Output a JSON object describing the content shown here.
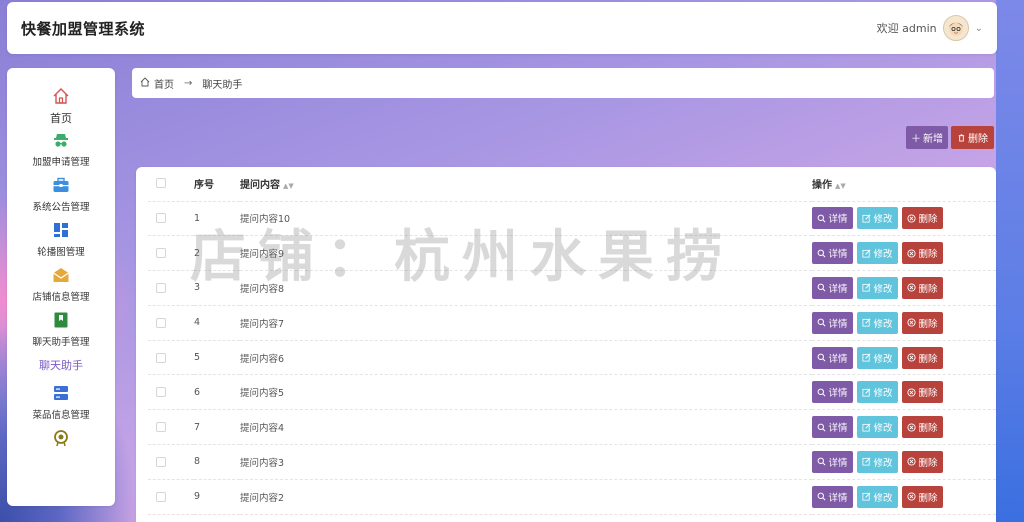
{
  "header": {
    "app_title": "快餐加盟管理系统",
    "welcome": "欢迎 admin"
  },
  "sidebar": {
    "items": [
      {
        "label": "首页",
        "icon": "home-icon"
      },
      {
        "label": "加盟申请管理",
        "icon": "spy-icon"
      },
      {
        "label": "系统公告管理",
        "icon": "briefcase-icon"
      },
      {
        "label": "轮播图管理",
        "icon": "grid-icon"
      },
      {
        "label": "店铺信息管理",
        "icon": "mail-icon"
      },
      {
        "label": "聊天助手管理",
        "icon": "bookmark-icon"
      },
      {
        "label": "菜品信息管理",
        "icon": "server-icon"
      }
    ],
    "active_sub": "聊天助手"
  },
  "breadcrumb": {
    "home": "首页",
    "current": "聊天助手"
  },
  "actions": {
    "add": "新增",
    "delete": "删除"
  },
  "table": {
    "headers": {
      "index": "序号",
      "question": "提问内容",
      "ops": "操作"
    },
    "op_labels": {
      "detail": "详情",
      "edit": "修改",
      "delete": "删除"
    },
    "rows": [
      {
        "index": "1",
        "question": "提问内容10"
      },
      {
        "index": "2",
        "question": "提问内容9"
      },
      {
        "index": "3",
        "question": "提问内容8"
      },
      {
        "index": "4",
        "question": "提问内容7"
      },
      {
        "index": "5",
        "question": "提问内容6"
      },
      {
        "index": "6",
        "question": "提问内容5"
      },
      {
        "index": "7",
        "question": "提问内容4"
      },
      {
        "index": "8",
        "question": "提问内容3"
      },
      {
        "index": "9",
        "question": "提问内容2"
      }
    ]
  },
  "watermark": "店铺：杭州水果捞",
  "colors": {
    "primary": "#7f5aa6",
    "danger": "#b8433c",
    "info": "#5fc4dc"
  }
}
